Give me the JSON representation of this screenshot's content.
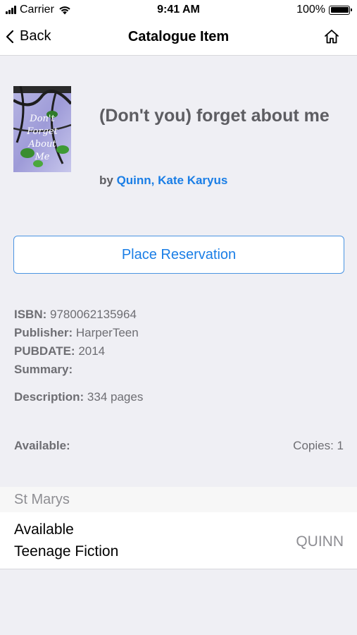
{
  "status_bar": {
    "carrier": "Carrier",
    "time": "9:41 AM",
    "battery": "100%"
  },
  "nav": {
    "back_label": "Back",
    "title": "Catalogue Item"
  },
  "book": {
    "title": "(Don't you) forget about me",
    "by_prefix": "by",
    "author": "Quinn, Kate Karyus",
    "cover_text": "Don't You Forget About Me"
  },
  "actions": {
    "reserve_label": "Place Reservation"
  },
  "details": {
    "isbn_label": "ISBN:",
    "isbn": "9780062135964",
    "publisher_label": "Publisher:",
    "publisher": "HarperTeen",
    "pubdate_label": "PUBDATE:",
    "pubdate": "2014",
    "summary_label": "Summary:",
    "description_label": "Description:",
    "description": "334 pages"
  },
  "availability": {
    "label": "Available:",
    "copies": "Copies: 1"
  },
  "holdings": {
    "branch": "St Marys",
    "items": [
      {
        "status": "Available",
        "collection": "Teenage Fiction",
        "call_number": "QUINN"
      }
    ]
  }
}
